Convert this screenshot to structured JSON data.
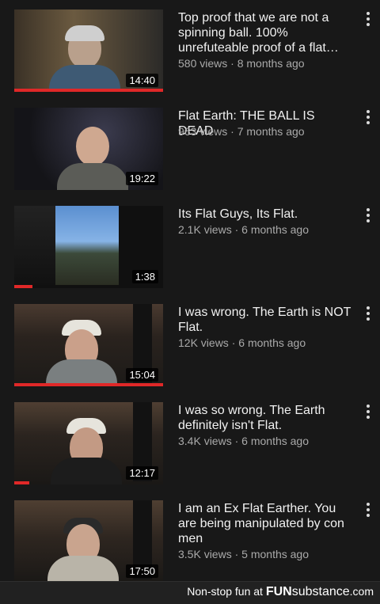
{
  "videos": [
    {
      "title": "Top proof that we are not a spinning ball. 100% unrefuteable proof of a flat…",
      "views": "580 views",
      "age": "8 months ago",
      "duration": "14:40",
      "watched": 1.0,
      "menu_icon": "more-vert-icon"
    },
    {
      "title": "Flat Earth: THE BALL IS DEAD",
      "views": "963 views",
      "age": "7 months ago",
      "duration": "19:22",
      "watched": 0.0,
      "menu_icon": "more-vert-icon"
    },
    {
      "title": "Its Flat Guys, Its Flat.",
      "views": "2.1K views",
      "age": "6 months ago",
      "duration": "1:38",
      "watched": 0.12,
      "menu_icon": "more-vert-icon"
    },
    {
      "title": "I was wrong. The Earth is NOT Flat.",
      "views": "12K views",
      "age": "6 months ago",
      "duration": "15:04",
      "watched": 1.0,
      "menu_icon": "more-vert-icon"
    },
    {
      "title": "I was so wrong. The Earth definitely isn't Flat.",
      "views": "3.4K views",
      "age": "6 months ago",
      "duration": "12:17",
      "watched": 0.1,
      "menu_icon": "more-vert-icon"
    },
    {
      "title": "I am an Ex Flat Earther. You are being manipulated by con men",
      "views": "3.5K views",
      "age": "5 months ago",
      "duration": "17:50",
      "watched": 0.0,
      "menu_icon": "more-vert-icon"
    }
  ],
  "meta_separator": " · ",
  "footer": {
    "tagline": "Non-stop fun at ",
    "brand_bold": "FUN",
    "brand_rest": "substance",
    "brand_tld": ".com"
  },
  "colors": {
    "background": "#181818",
    "progress": "#e02828",
    "meta_text": "#aaaaaa"
  }
}
